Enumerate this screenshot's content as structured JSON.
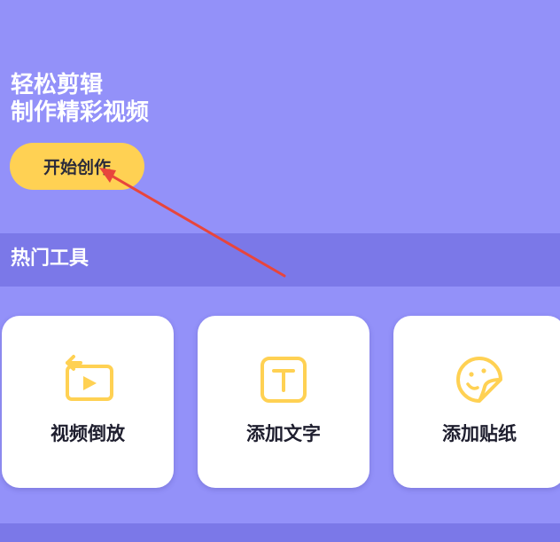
{
  "hero": {
    "line1": "轻松剪辑",
    "line2": "制作精彩视频",
    "start_button": "开始创作"
  },
  "hot_tools": {
    "title": "热门工具",
    "items": [
      {
        "label": "视频倒放",
        "icon": "video-reverse-icon"
      },
      {
        "label": "添加文字",
        "icon": "text-t-icon"
      },
      {
        "label": "添加贴纸",
        "icon": "sticker-icon"
      }
    ]
  },
  "next_section": {
    "title": ""
  },
  "colors": {
    "background": "#9391f9",
    "section_bar": "#7b78e8",
    "accent_yellow": "#ffd153",
    "annotation_arrow": "#e8453c"
  }
}
